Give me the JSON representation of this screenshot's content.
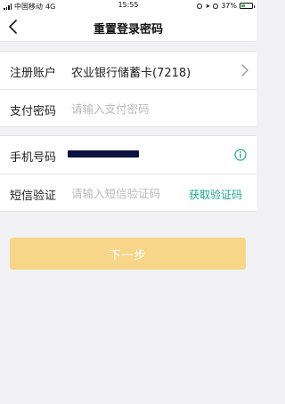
{
  "status_bar": {
    "carrier": "中国移动",
    "network": "4G",
    "time": "15:55",
    "battery": "37%",
    "battery_level": 0.37,
    "battery_color": "#3fb84a"
  },
  "nav": {
    "title": "重置登录密码",
    "back_icon": "chevron-left-icon"
  },
  "account_form": {
    "account_label": "注册账户",
    "account_value": "农业银行储蓄卡(7218)",
    "payment_password_label": "支付密码",
    "payment_password_placeholder": "请输入支付密码"
  },
  "verify_form": {
    "phone_label": "手机号码",
    "sms_label": "短信验证",
    "sms_placeholder": "请输入短信验证码",
    "get_code_label": "获取验证码",
    "info_icon": "info-circle-icon"
  },
  "next_button_label": "下一步",
  "colors": {
    "accent_green": "#1fa889",
    "next_button_disabled": "#f7d68a",
    "background": "#f2f2f4"
  }
}
